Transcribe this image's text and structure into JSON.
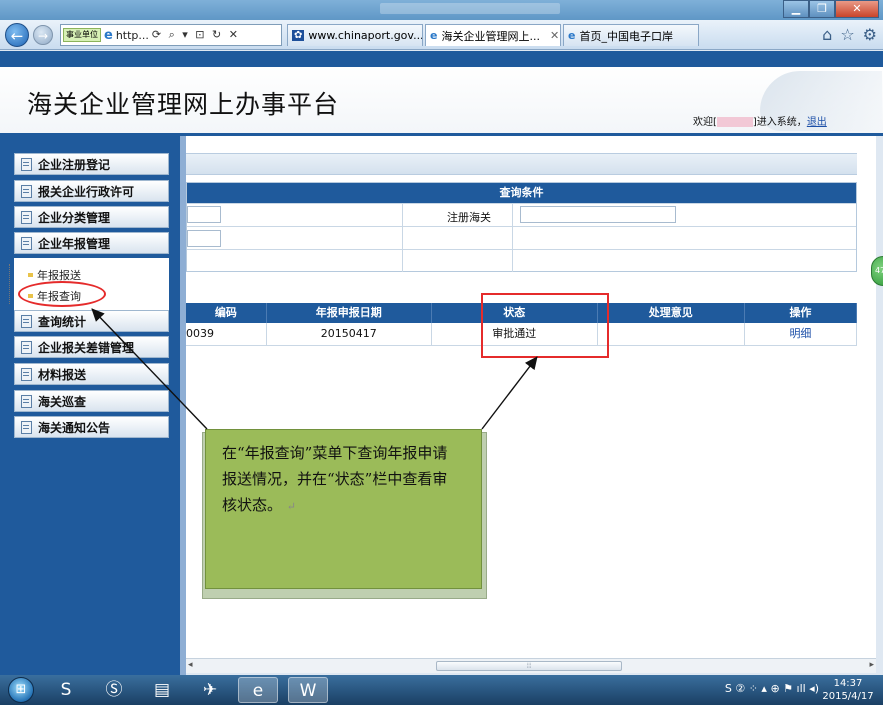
{
  "browser": {
    "address_tag": "事业单位",
    "address_url": "http...",
    "address_tools": "⟳ ⌕ ▾ ⊡ ↻ ✕",
    "tabs": [
      {
        "label": "www.chinaport.gov....",
        "icon": "customs-paw-icon"
      },
      {
        "label": "海关企业管理网上...",
        "icon": "ie-icon"
      },
      {
        "label": "首页_中国电子口岸",
        "icon": "ie-icon"
      }
    ],
    "nav_icons": [
      "home-icon",
      "favorites-star-icon",
      "settings-gear-icon"
    ]
  },
  "header": {
    "title": "海关企业管理网上办事平台",
    "welcome_prefix": "欢迎[",
    "welcome_suffix": "]进入系统，",
    "logout": "退出"
  },
  "sidebar": {
    "items_top": [
      {
        "label": "企业注册登记"
      },
      {
        "label": "报关企业行政许可"
      },
      {
        "label": "企业分类管理"
      },
      {
        "label": "企业年报管理"
      }
    ],
    "sub_items": [
      {
        "label": "年报报送"
      },
      {
        "label": "年报查询"
      }
    ],
    "items_bottom": [
      {
        "label": "查询统计"
      },
      {
        "label": "企业报关差错管理"
      },
      {
        "label": "材料报送"
      },
      {
        "label": "海关巡查"
      },
      {
        "label": "海关通知公告"
      }
    ]
  },
  "query": {
    "header": "查询条件",
    "customs_label": "注册海关"
  },
  "results": {
    "columns": [
      "编码",
      "年报申报日期",
      "状态",
      "处理意见",
      "操作"
    ],
    "rows": [
      {
        "code": "0039",
        "date": "20150417",
        "status": "审批通过",
        "opinion": "",
        "action": "明细"
      }
    ]
  },
  "callout": {
    "text": "在“年报查询”菜单下查询年报申请报送情况，并在“状态”栏中查看审核状态。",
    "return_mark": "↵"
  },
  "side_widget": "47",
  "taskbar": {
    "apps": [
      "sogou-icon",
      "sogou-browser-icon",
      "folder-icon",
      "plane-icon",
      "ie-icon",
      "word-icon"
    ],
    "tray": "S ② ⁘ ▴ ⊕ ⚑ ıll ◂)",
    "time": "14:37",
    "date": "2015/4/17"
  },
  "colors": {
    "primary_blue": "#1f5a9c",
    "callout_green": "#9bbb59",
    "highlight_red": "#e52b2b"
  }
}
